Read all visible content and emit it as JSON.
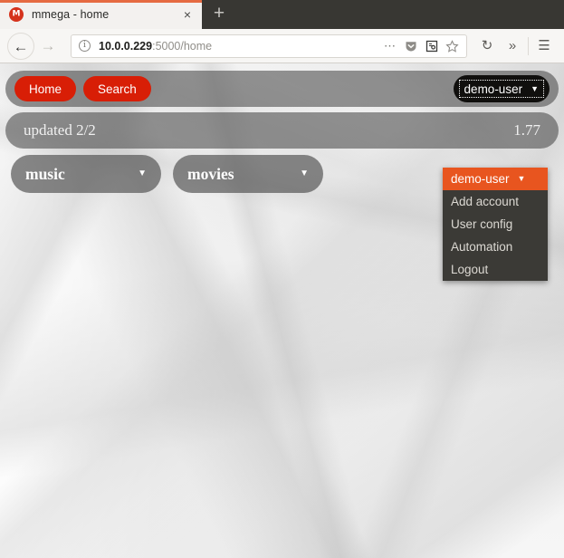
{
  "browser": {
    "tab": {
      "title": "mmega - home",
      "favicon_label": "mmega-favicon",
      "close_label": "×"
    },
    "newtab_label": "+",
    "back_label": "←",
    "forward_label": "→",
    "url": {
      "host": "10.0.0.229",
      "rest": ":5000/home",
      "info_label": "i"
    },
    "urlbar_icons": [
      "page-actions-icon",
      "pocket-icon",
      "reader-view-icon",
      "bookmark-star-icon"
    ],
    "toolbar_icons": [
      "reload-icon",
      "overflow-chevrons-icon",
      "hamburger-menu-icon"
    ],
    "reload_label": "↻",
    "overflow_label": "»",
    "menu_label": "☰"
  },
  "page": {
    "nav": {
      "home_label": "Home",
      "search_label": "Search",
      "user_button_label": "demo-user",
      "caret": "▼"
    },
    "status": {
      "updated_label": "updated 2/2",
      "size_value": "1.77"
    },
    "selects": [
      {
        "label": "music",
        "caret": "▼"
      },
      {
        "label": "movies",
        "caret": "▼"
      }
    ],
    "dropdown": {
      "items": [
        {
          "label": "demo-user",
          "caret": "▼",
          "selected": true
        },
        {
          "label": "Add account",
          "caret": "",
          "selected": false
        },
        {
          "label": "User config",
          "caret": "",
          "selected": false
        },
        {
          "label": "Automation",
          "caret": "",
          "selected": false
        },
        {
          "label": "Logout",
          "caret": "",
          "selected": false
        }
      ]
    }
  },
  "colors": {
    "accent_red": "#d81e06",
    "highlight_orange": "#e8551f",
    "menu_dark": "#3b3a36",
    "bar_gray": "rgba(78,78,78,0.60)",
    "tab_accent": "#e56a42"
  }
}
